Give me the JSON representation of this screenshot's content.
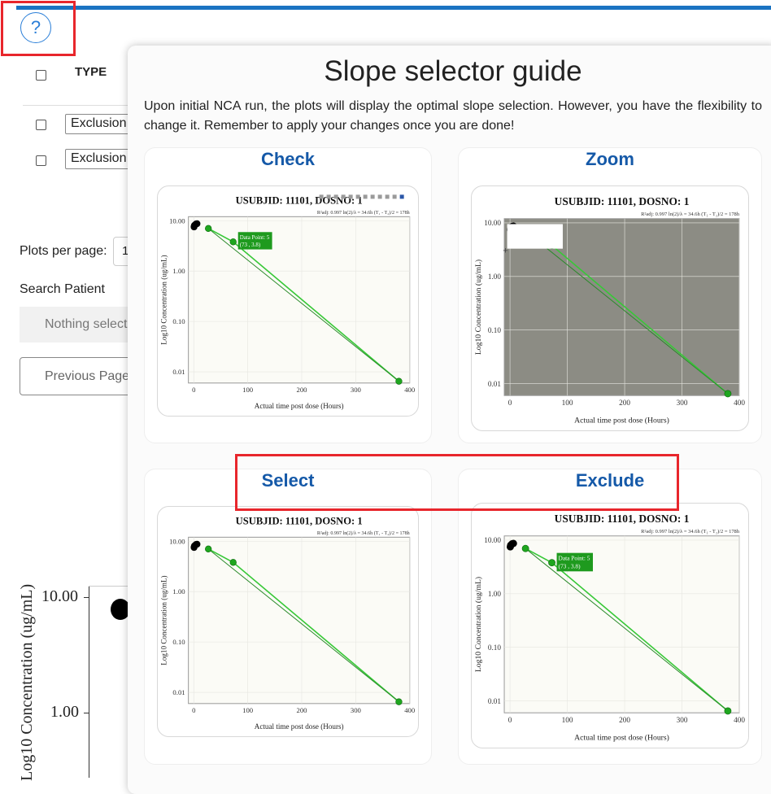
{
  "help_button": {
    "label": "?"
  },
  "table": {
    "type_header": "TYPE",
    "rows": [
      {
        "type_value": "Exclusion"
      },
      {
        "type_value": "Exclusion"
      }
    ]
  },
  "controls": {
    "plots_per_page_label": "Plots per page:",
    "plots_per_page_value": "1",
    "search_patient_label": "Search Patient",
    "search_placeholder": "Nothing selected",
    "previous_page_label": "Previous Page"
  },
  "background_chart": {
    "ytick_top": "10.00",
    "ytick_mid": "1.00",
    "ylabel": "Log10 Concentration (ug/mL)"
  },
  "modal": {
    "title": "Slope selector guide",
    "description": "Upon initial NCA run, the plots will display the optimal slope selection. However, you have the flexibility to change it. Remember to apply your changes once you are done!",
    "cards": [
      {
        "title": "Check"
      },
      {
        "title": "Zoom"
      },
      {
        "title": "Select"
      },
      {
        "title": "Exclude"
      }
    ]
  },
  "chart_data": {
    "type": "scatter",
    "title": "USUBJID: 11101, DOSNO: 1",
    "subtitle": "R²adj: 0.997    ln(2)/λ = 34.6h    (T₁ - T₂)/2 = 178h",
    "xlabel": "Actual time post dose (Hours)",
    "ylabel": "Log10 Concentration (ug/mL)",
    "x_ticks": [
      "0",
      "100",
      "200",
      "300",
      "400"
    ],
    "y_ticks": [
      "10.00",
      "1.00",
      "0.10",
      "0.01"
    ],
    "xlim": [
      -10,
      400
    ],
    "y_scale": "log",
    "ylim": [
      0.006,
      12
    ],
    "colors": {
      "selected": "#1fa61f",
      "excluded": "#000000",
      "line": "#37c837",
      "fit_line": "#2a8a2a"
    },
    "excluded_points": [
      {
        "x": 0.5,
        "y": 7.5
      },
      {
        "x": 1,
        "y": 8.0
      },
      {
        "x": 2,
        "y": 8.2
      },
      {
        "x": 4,
        "y": 8.6
      },
      {
        "x": 6,
        "y": 8.7
      }
    ],
    "selected_points": [
      {
        "x": 27,
        "y": 7.0
      },
      {
        "x": 73,
        "y": 3.8
      },
      {
        "x": 380,
        "y": 0.0065
      }
    ],
    "tooltip": {
      "line1": "Data Point: 5",
      "line2": "(73 , 3.8)"
    }
  }
}
